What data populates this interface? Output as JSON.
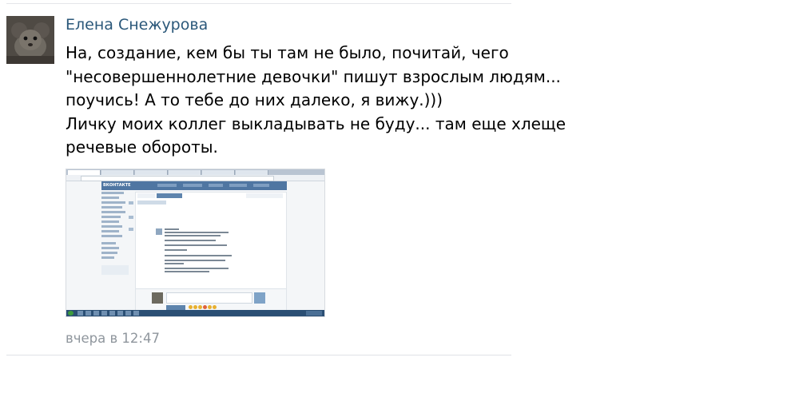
{
  "post": {
    "author": "Елена Снежурова",
    "text_lines": [
      "На, создание, кем бы ты там не было, почитай, чего",
      "\"несовершеннолетние девочки\" пишут взрослым людям...",
      "поучись! А то тебе до них далеко, я вижу.)))",
      "Личку моих коллег выкладывать не буду... там еще хлеще",
      "речевые обороты."
    ],
    "timestamp": "вчера в 12:47"
  },
  "icons": {
    "avatar": "avatar-image",
    "attachment": "screenshot-photo"
  },
  "colors": {
    "author_link": "#2b587a",
    "timestamp": "#8f969d",
    "divider": "#e4e6e9"
  }
}
